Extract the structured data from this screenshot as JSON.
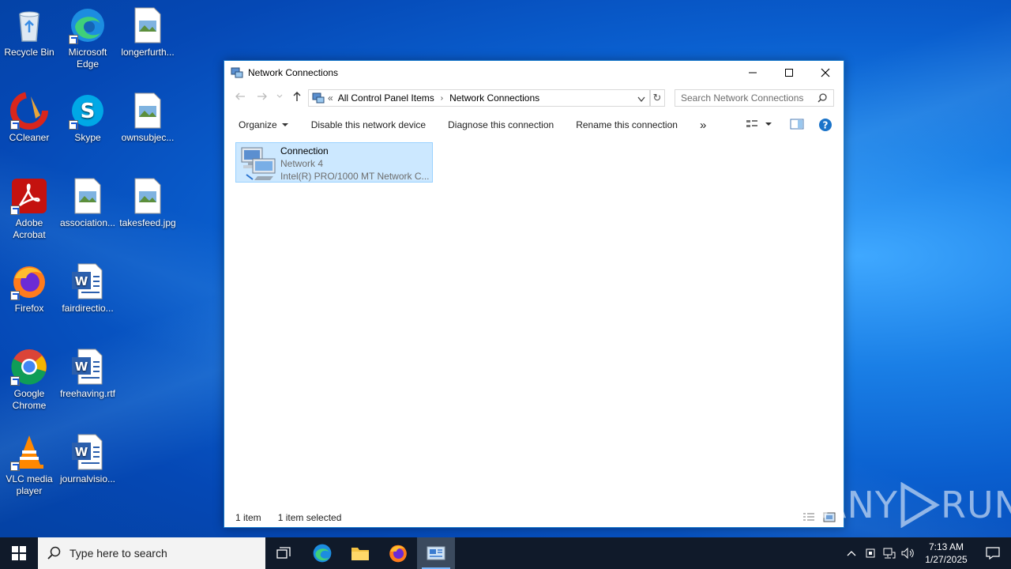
{
  "desktop": {
    "icons": [
      {
        "label": "Recycle Bin",
        "icon": "recycle-bin-icon"
      },
      {
        "label": "Microsoft Edge",
        "icon": "edge-icon"
      },
      {
        "label": "longerfurth...",
        "icon": "image-file-icon"
      },
      {
        "label": "CCleaner",
        "icon": "ccleaner-icon"
      },
      {
        "label": "Skype",
        "icon": "skype-icon"
      },
      {
        "label": "ownsubjec...",
        "icon": "image-file-icon"
      },
      {
        "label": "Adobe Acrobat",
        "icon": "acrobat-icon"
      },
      {
        "label": "association...",
        "icon": "image-file-icon"
      },
      {
        "label": "takesfeed.jpg",
        "icon": "image-file-icon"
      },
      {
        "label": "Firefox",
        "icon": "firefox-icon"
      },
      {
        "label": "fairdirectio...",
        "icon": "word-doc-icon"
      },
      {
        "label": "Google Chrome",
        "icon": "chrome-icon"
      },
      {
        "label": "freehaving.rtf",
        "icon": "word-doc-icon"
      },
      {
        "label": "VLC media player",
        "icon": "vlc-icon"
      },
      {
        "label": "journalvisio...",
        "icon": "word-doc-icon"
      }
    ]
  },
  "window": {
    "title": "Network Connections",
    "breadcrumb": {
      "overflow": "«",
      "items": [
        "All Control Panel Items",
        "Network Connections"
      ]
    },
    "search_placeholder": "Search Network Connections",
    "commands": {
      "organize": "Organize",
      "disable": "Disable this network device",
      "diagnose": "Diagnose this connection",
      "rename": "Rename this connection",
      "more": "»"
    },
    "items": [
      {
        "name": "Connection",
        "network": "Network  4",
        "adapter": "Intel(R) PRO/1000 MT Network C..."
      }
    ],
    "status": {
      "count": "1 item",
      "selected": "1 item selected"
    }
  },
  "taskbar": {
    "search_placeholder": "Type here to search",
    "time": "7:13 AM",
    "date": "1/27/2025"
  },
  "watermark": {
    "text_left": "ANY",
    "text_right": "RUN"
  },
  "colors": {
    "accent": "#0078d7",
    "selection": "#cce8ff",
    "taskbar": "#101a2a"
  }
}
